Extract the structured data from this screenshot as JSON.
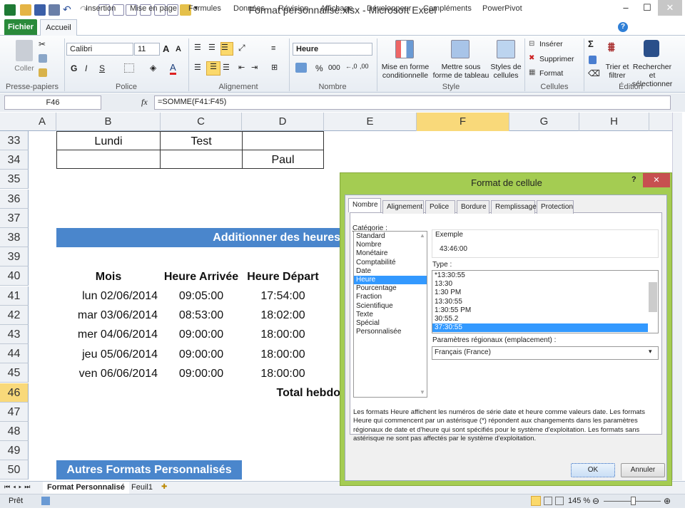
{
  "window": {
    "title": "Format personnalisé.xlsx - Microsoft Excel"
  },
  "ribbon_tabs": [
    "Fichier",
    "Accueil",
    "Insertion",
    "Mise en page",
    "Formules",
    "Données",
    "Révision",
    "Affichage",
    "Développeur",
    "Compléments",
    "PowerPivot"
  ],
  "ribbon": {
    "clipboard": {
      "paste": "Coller",
      "group": "Presse-papiers"
    },
    "font": {
      "name": "Calibri",
      "size": "11",
      "bold": "G",
      "italic": "I",
      "underline": "S",
      "group": "Police"
    },
    "alignment": {
      "group": "Alignement"
    },
    "number": {
      "format": "Heure",
      "percent": "%",
      "thousands": "000",
      "group": "Nombre"
    },
    "style": {
      "conditional": "Mise en forme conditionnelle",
      "table": "Mettre sous forme de tableau",
      "cell_styles": "Styles de cellules",
      "group": "Style"
    },
    "cells": {
      "insert": "Insérer",
      "delete": "Supprimer",
      "format": "Format",
      "group": "Cellules"
    },
    "editing": {
      "sort": "Trier et filtrer",
      "find": "Rechercher et sélectionner",
      "group": "Édition"
    }
  },
  "formula_bar": {
    "name_box": "F46",
    "fx": "fx",
    "formula": "=SOMME(F41:F45)"
  },
  "columns": [
    "A",
    "B",
    "C",
    "D",
    "E",
    "F",
    "G",
    "H"
  ],
  "rows": [
    "33",
    "34",
    "35",
    "36",
    "37",
    "38",
    "39",
    "40",
    "41",
    "42",
    "43",
    "44",
    "45",
    "46",
    "47",
    "48",
    "49",
    "50"
  ],
  "cells": {
    "b33": "Lundi",
    "c33": "Test",
    "d34": "Paul",
    "band38": "Additionner des heures",
    "headers": [
      "Mois",
      "Heure Arrivée",
      "Heure Départ"
    ],
    "data": [
      [
        "lun 02/06/2014",
        "09:05:00",
        "17:54:00"
      ],
      [
        "mar 03/06/2014",
        "08:53:00",
        "18:02:00"
      ],
      [
        "mer 04/06/2014",
        "09:00:00",
        "18:00:00"
      ],
      [
        "jeu 05/06/2014",
        "09:00:00",
        "18:00:00"
      ],
      [
        "ven 06/06/2014",
        "09:00:00",
        "18:00:00"
      ]
    ],
    "total": "Total hebdo",
    "band50": "Autres Formats Personnalisés"
  },
  "sheets": [
    "Format Personnalisé",
    "Feuil1"
  ],
  "status": {
    "ready": "Prêt",
    "zoom": "145 %"
  },
  "dialog": {
    "title": "Format de cellule",
    "help": "?",
    "close": "✕",
    "tabs": [
      "Nombre",
      "Alignement",
      "Police",
      "Bordure",
      "Remplissage",
      "Protection"
    ],
    "category_label": "Catégorie :",
    "categories": [
      "Standard",
      "Nombre",
      "Monétaire",
      "Comptabilité",
      "Date",
      "Heure",
      "Pourcentage",
      "Fraction",
      "Scientifique",
      "Texte",
      "Spécial",
      "Personnalisée"
    ],
    "selected_category": "Heure",
    "example_label": "Exemple",
    "example_value": "43:46:00",
    "type_label": "Type :",
    "types": [
      "*13:30:55",
      "13:30",
      "1:30 PM",
      "13:30:55",
      "1:30:55 PM",
      "30:55.2",
      "37:30:55"
    ],
    "selected_type": "37:30:55",
    "locale_label": "Paramètres régionaux (emplacement) :",
    "locale_value": "Français (France)",
    "description": "Les formats Heure affichent les numéros de série date et heure comme valeurs date. Les formats Heure qui commencent par un astérisque (*) répondent aux changements dans les paramètres régionaux de date et d'heure qui sont spécifiés pour le système d'exploitation. Les formats sans astérisque ne sont pas affectés par le système d'exploitation.",
    "ok": "OK",
    "cancel": "Annuler"
  }
}
